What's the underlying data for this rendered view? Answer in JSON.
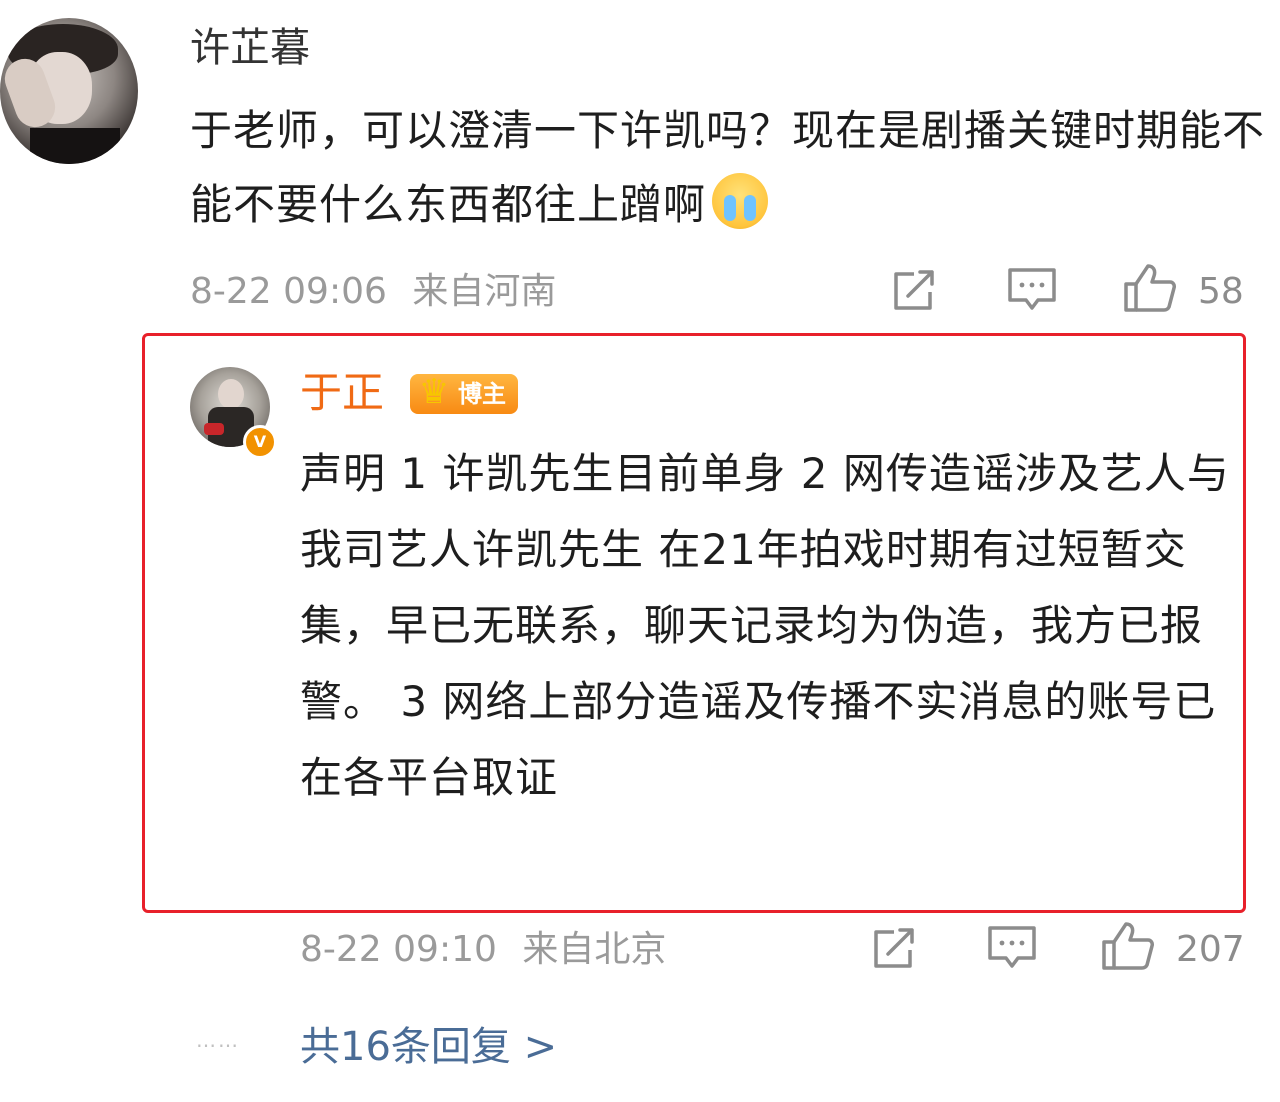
{
  "top_comment": {
    "username": "许芷暮",
    "text": "于老师，可以澄清一下许凯吗？现在是剧播关键时期能不能不要什么东西都往上蹭啊",
    "emoji": "cry-emoji",
    "timestamp": "8-22 09:06",
    "location": "来自河南",
    "like_count": "58"
  },
  "reply": {
    "username": "于正",
    "badge_label": "博主",
    "verified": "V",
    "text": "声明 1 许凯先生目前单身 2 网传造谣涉及艺人与我司艺人许凯先生 在21年拍戏时期有过短暂交集，早已无联系，聊天记录均为伪造，我方已报警。 3 网络上部分造谣及传播不实消息的账号已在各平台取证",
    "timestamp": "8-22 09:10",
    "location": "来自北京",
    "like_count": "207"
  },
  "more_replies": {
    "dots": "……",
    "label": "共16条回复 >"
  },
  "colors": {
    "highlight_border": "#e8202a",
    "reply_username": "#f06a14",
    "link": "#4a6c96",
    "meta": "#9a9a9a"
  },
  "icons": [
    "repost-icon",
    "comment-icon",
    "like-icon"
  ]
}
